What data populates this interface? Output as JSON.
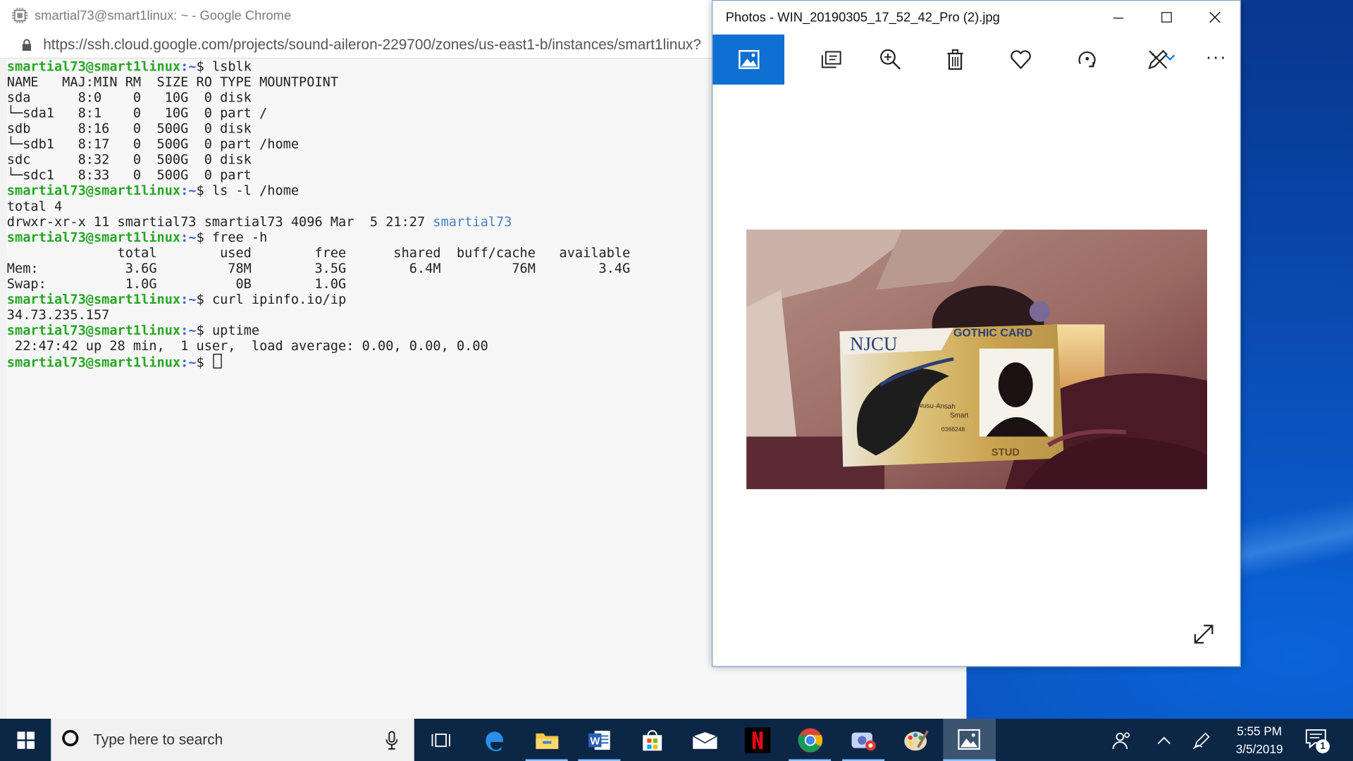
{
  "chrome": {
    "title": "smartial73@smart1linux: ~ - Google Chrome",
    "url": "https://ssh.cloud.google.com/projects/sound-aileron-229700/zones/us-east1-b/instances/smart1linux?"
  },
  "terminal": {
    "prompt_user": "smartial73@smart1linux",
    "prompt_path": ":~",
    "prompt_symbol": "$ ",
    "lines": [
      {
        "type": "cmd",
        "text": "lsblk"
      },
      {
        "type": "out",
        "text": "NAME   MAJ:MIN RM  SIZE RO TYPE MOUNTPOINT"
      },
      {
        "type": "out",
        "text": "sda      8:0    0   10G  0 disk"
      },
      {
        "type": "out",
        "text": "└─sda1   8:1    0   10G  0 part /"
      },
      {
        "type": "out",
        "text": "sdb      8:16   0  500G  0 disk"
      },
      {
        "type": "out",
        "text": "└─sdb1   8:17   0  500G  0 part /home"
      },
      {
        "type": "out",
        "text": "sdc      8:32   0  500G  0 disk"
      },
      {
        "type": "out",
        "text": "└─sdc1   8:33   0  500G  0 part"
      },
      {
        "type": "cmd",
        "text": "ls -l /home"
      },
      {
        "type": "out",
        "text": "total 4"
      },
      {
        "type": "dir",
        "text": "drwxr-xr-x 11 smartial73 smartial73 4096 Mar  5 21:27 ",
        "dir": "smartial73"
      },
      {
        "type": "cmd",
        "text": "free -h"
      },
      {
        "type": "out",
        "text": "              total        used        free      shared  buff/cache   available"
      },
      {
        "type": "out",
        "text": "Mem:           3.6G         78M        3.5G        6.4M         76M        3.4G"
      },
      {
        "type": "out",
        "text": "Swap:          1.0G          0B        1.0G"
      },
      {
        "type": "cmd",
        "text": "curl ipinfo.io/ip"
      },
      {
        "type": "out",
        "text": "34.73.235.157"
      },
      {
        "type": "cmd",
        "text": "uptime"
      },
      {
        "type": "out",
        "text": " 22:47:42 up 28 min,  1 user,  load average: 0.00, 0.00, 0.00"
      },
      {
        "type": "cursor",
        "text": ""
      }
    ]
  },
  "photos": {
    "title": "Photos - WIN_20190305_17_52_42_Pro (2).jpg",
    "toolbar": [
      "photo-icon",
      "slideshow-icon",
      "zoom-icon",
      "delete-icon",
      "favorite-icon",
      "rotate-icon",
      "edit-icon",
      "more-icon"
    ],
    "more_label": "···",
    "card": {
      "logo": "NJCU",
      "heading": "GOTHIC CARD",
      "name1": "Owusu-Ansah",
      "name2": "Smart",
      "id": "0366248",
      "role": "STUD"
    }
  },
  "taskbar": {
    "search_placeholder": "Type here to search",
    "time": "5:55 PM",
    "date": "3/5/2019",
    "notification_count": "1"
  },
  "colors": {
    "prompt_user": "#27a627",
    "prompt_path": "#3a5fcd",
    "dir": "#4a7fc4",
    "photos_accent": "#0f6fd3",
    "taskbar": "#0c2746"
  }
}
